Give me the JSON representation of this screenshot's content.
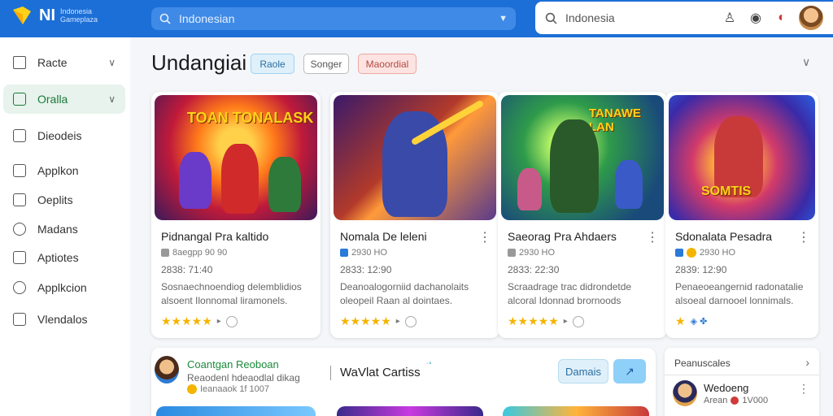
{
  "logo": {
    "title": "NI",
    "line1": "Indonesia",
    "line2": "Gameplaza"
  },
  "search_primary": {
    "text": "Indonesian"
  },
  "search_secondary": {
    "text": "Indonesia"
  },
  "sidebar": {
    "items": [
      {
        "label": "Racte",
        "chevron": true,
        "active": false
      },
      {
        "label": "Oralla",
        "chevron": true,
        "active": true
      },
      {
        "label": "Dieodeis",
        "chevron": false,
        "active": false
      },
      {
        "label": "Applkon",
        "chevron": false,
        "active": false
      },
      {
        "label": "Oeplits",
        "chevron": false,
        "active": false
      },
      {
        "label": "Madans",
        "chevron": false,
        "active": false
      },
      {
        "label": "Aptiotes",
        "chevron": false,
        "active": false
      },
      {
        "label": "Applkcion",
        "chevron": false,
        "active": false
      },
      {
        "label": "Vlendalos",
        "chevron": false,
        "active": false
      }
    ]
  },
  "main": {
    "title": "Undangiai",
    "chips": [
      "Raole",
      "Songer",
      "Maoordial"
    ],
    "cards": [
      {
        "title": "Pidnangal Pra kaltido",
        "meta": "8aegpp 90 90",
        "date": "2838: 71:40",
        "desc": "Sosnaechnoendiog delemblidios alsoent Ilonnomal liramonels.",
        "banner": "TOAN TONALASK",
        "stars": "★★★★★"
      },
      {
        "title": "Nomala De leleni",
        "meta": "2930 HO",
        "date": "2833: 12:90",
        "desc": "Deanoalogorniid dachanolaits oleopeil Raan al dointaes.",
        "banner": "",
        "stars": "★★★★★"
      },
      {
        "title": "Saeorag Pra Ahdaers",
        "meta": "2930 HO",
        "date": "2833: 22:30",
        "desc": "Scraadrage trac didrondetde alcoral Idonnad brornoods",
        "banner": "TANAWE LAN",
        "stars": "★★★★★"
      },
      {
        "title": "Sdonalata Pesadra",
        "meta": "2930 HO",
        "date": "2839: 12:90",
        "desc": "Penaeoeangernid radonatalie alsoeal darnooel lonnimals.",
        "banner": "SOMTIS",
        "stars": "★"
      }
    ]
  },
  "lower": {
    "title": "Coantgan Reoboan",
    "sub": "Reaodenl hdeaodlal dikag",
    "sub2": "Ieanaaok 1f 1007",
    "section": "WaVlat Cartiss",
    "btn1": "Damais",
    "btn2": "↗"
  },
  "right_panel": {
    "title": "Peanuscales",
    "name": "Wedoeng",
    "sub": "Arean",
    "sub_value": "1V000"
  },
  "colors": {
    "topbar": "#1c6fd6",
    "accent_green": "#1a7a3a",
    "star": "#f4b400"
  }
}
